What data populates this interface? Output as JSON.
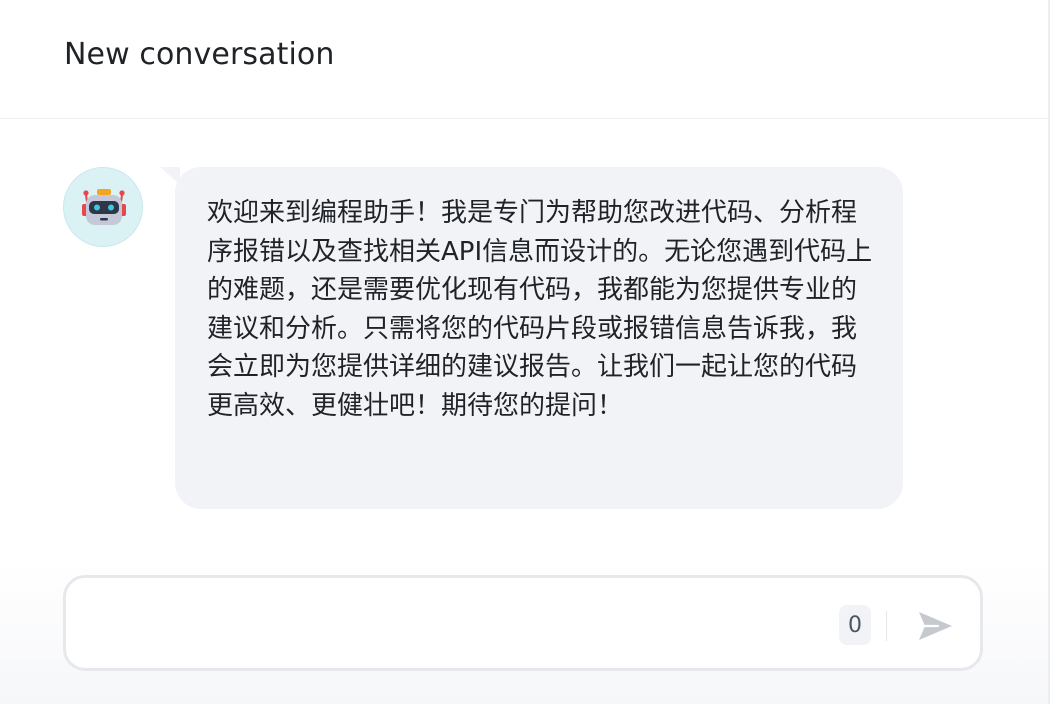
{
  "header": {
    "title": "New conversation"
  },
  "messages": [
    {
      "role": "assistant",
      "avatar": "robot-icon",
      "text": "欢迎来到编程助手！我是专门为帮助您改进代码、分析程序报错以及查找相关API信息而设计的。无论您遇到代码上的难题，还是需要优化现有代码，我都能为您提供专业的建议和分析。只需将您的代码片段或报错信息告诉我，我会立即为您提供详细的建议报告。让我们一起让您的代码更高效、更健壮吧！期待您的提问！"
    }
  ],
  "composer": {
    "value": "",
    "char_count": "0",
    "send_icon": "send-icon"
  },
  "colors": {
    "bubble": "#f2f3f7",
    "avatar_bg": "#daf2f4",
    "send_icon": "#c6c9cf",
    "border": "#e6e8ec"
  }
}
